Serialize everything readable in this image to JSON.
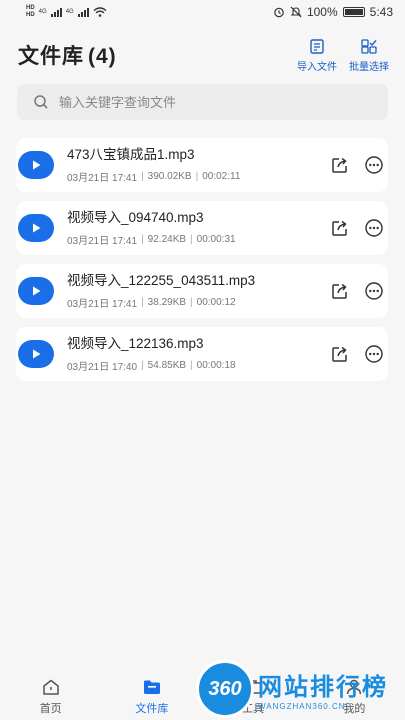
{
  "statusbar": {
    "net1": "HD",
    "net2": "HD",
    "gen1": "4G",
    "gen2": "4G",
    "battery_pct": "100%",
    "time": "5:43"
  },
  "header": {
    "title": "文件库",
    "count": "(4)",
    "import_label": "导入文件",
    "batch_label": "批量选择"
  },
  "search": {
    "placeholder": "输入关键字查询文件"
  },
  "files": [
    {
      "name": "473八宝镇成品1.mp3",
      "date": "03月21日 17:41",
      "size": "390.02KB",
      "duration": "00:02:11"
    },
    {
      "name": "视频导入_094740.mp3",
      "date": "03月21日 17:41",
      "size": "92.24KB",
      "duration": "00:00:31"
    },
    {
      "name": "视频导入_122255_043511.mp3",
      "date": "03月21日 17:41",
      "size": "38.29KB",
      "duration": "00:00:12"
    },
    {
      "name": "视频导入_122136.mp3",
      "date": "03月21日 17:40",
      "size": "54.85KB",
      "duration": "00:00:18"
    }
  ],
  "tabs": [
    {
      "label": "首页",
      "icon": "home-icon"
    },
    {
      "label": "文件库",
      "icon": "folder-icon",
      "active": true
    },
    {
      "label": "工具",
      "icon": "toolbox-icon"
    },
    {
      "label": "我的",
      "icon": "user-icon"
    }
  ],
  "watermark": {
    "logo": "360",
    "cn": "网站排行榜",
    "en": "WANGZHAN360.CN"
  },
  "colors": {
    "accent": "#1a6fe8",
    "header_action": "#1a5fc8",
    "background": "#f6f6f6"
  }
}
